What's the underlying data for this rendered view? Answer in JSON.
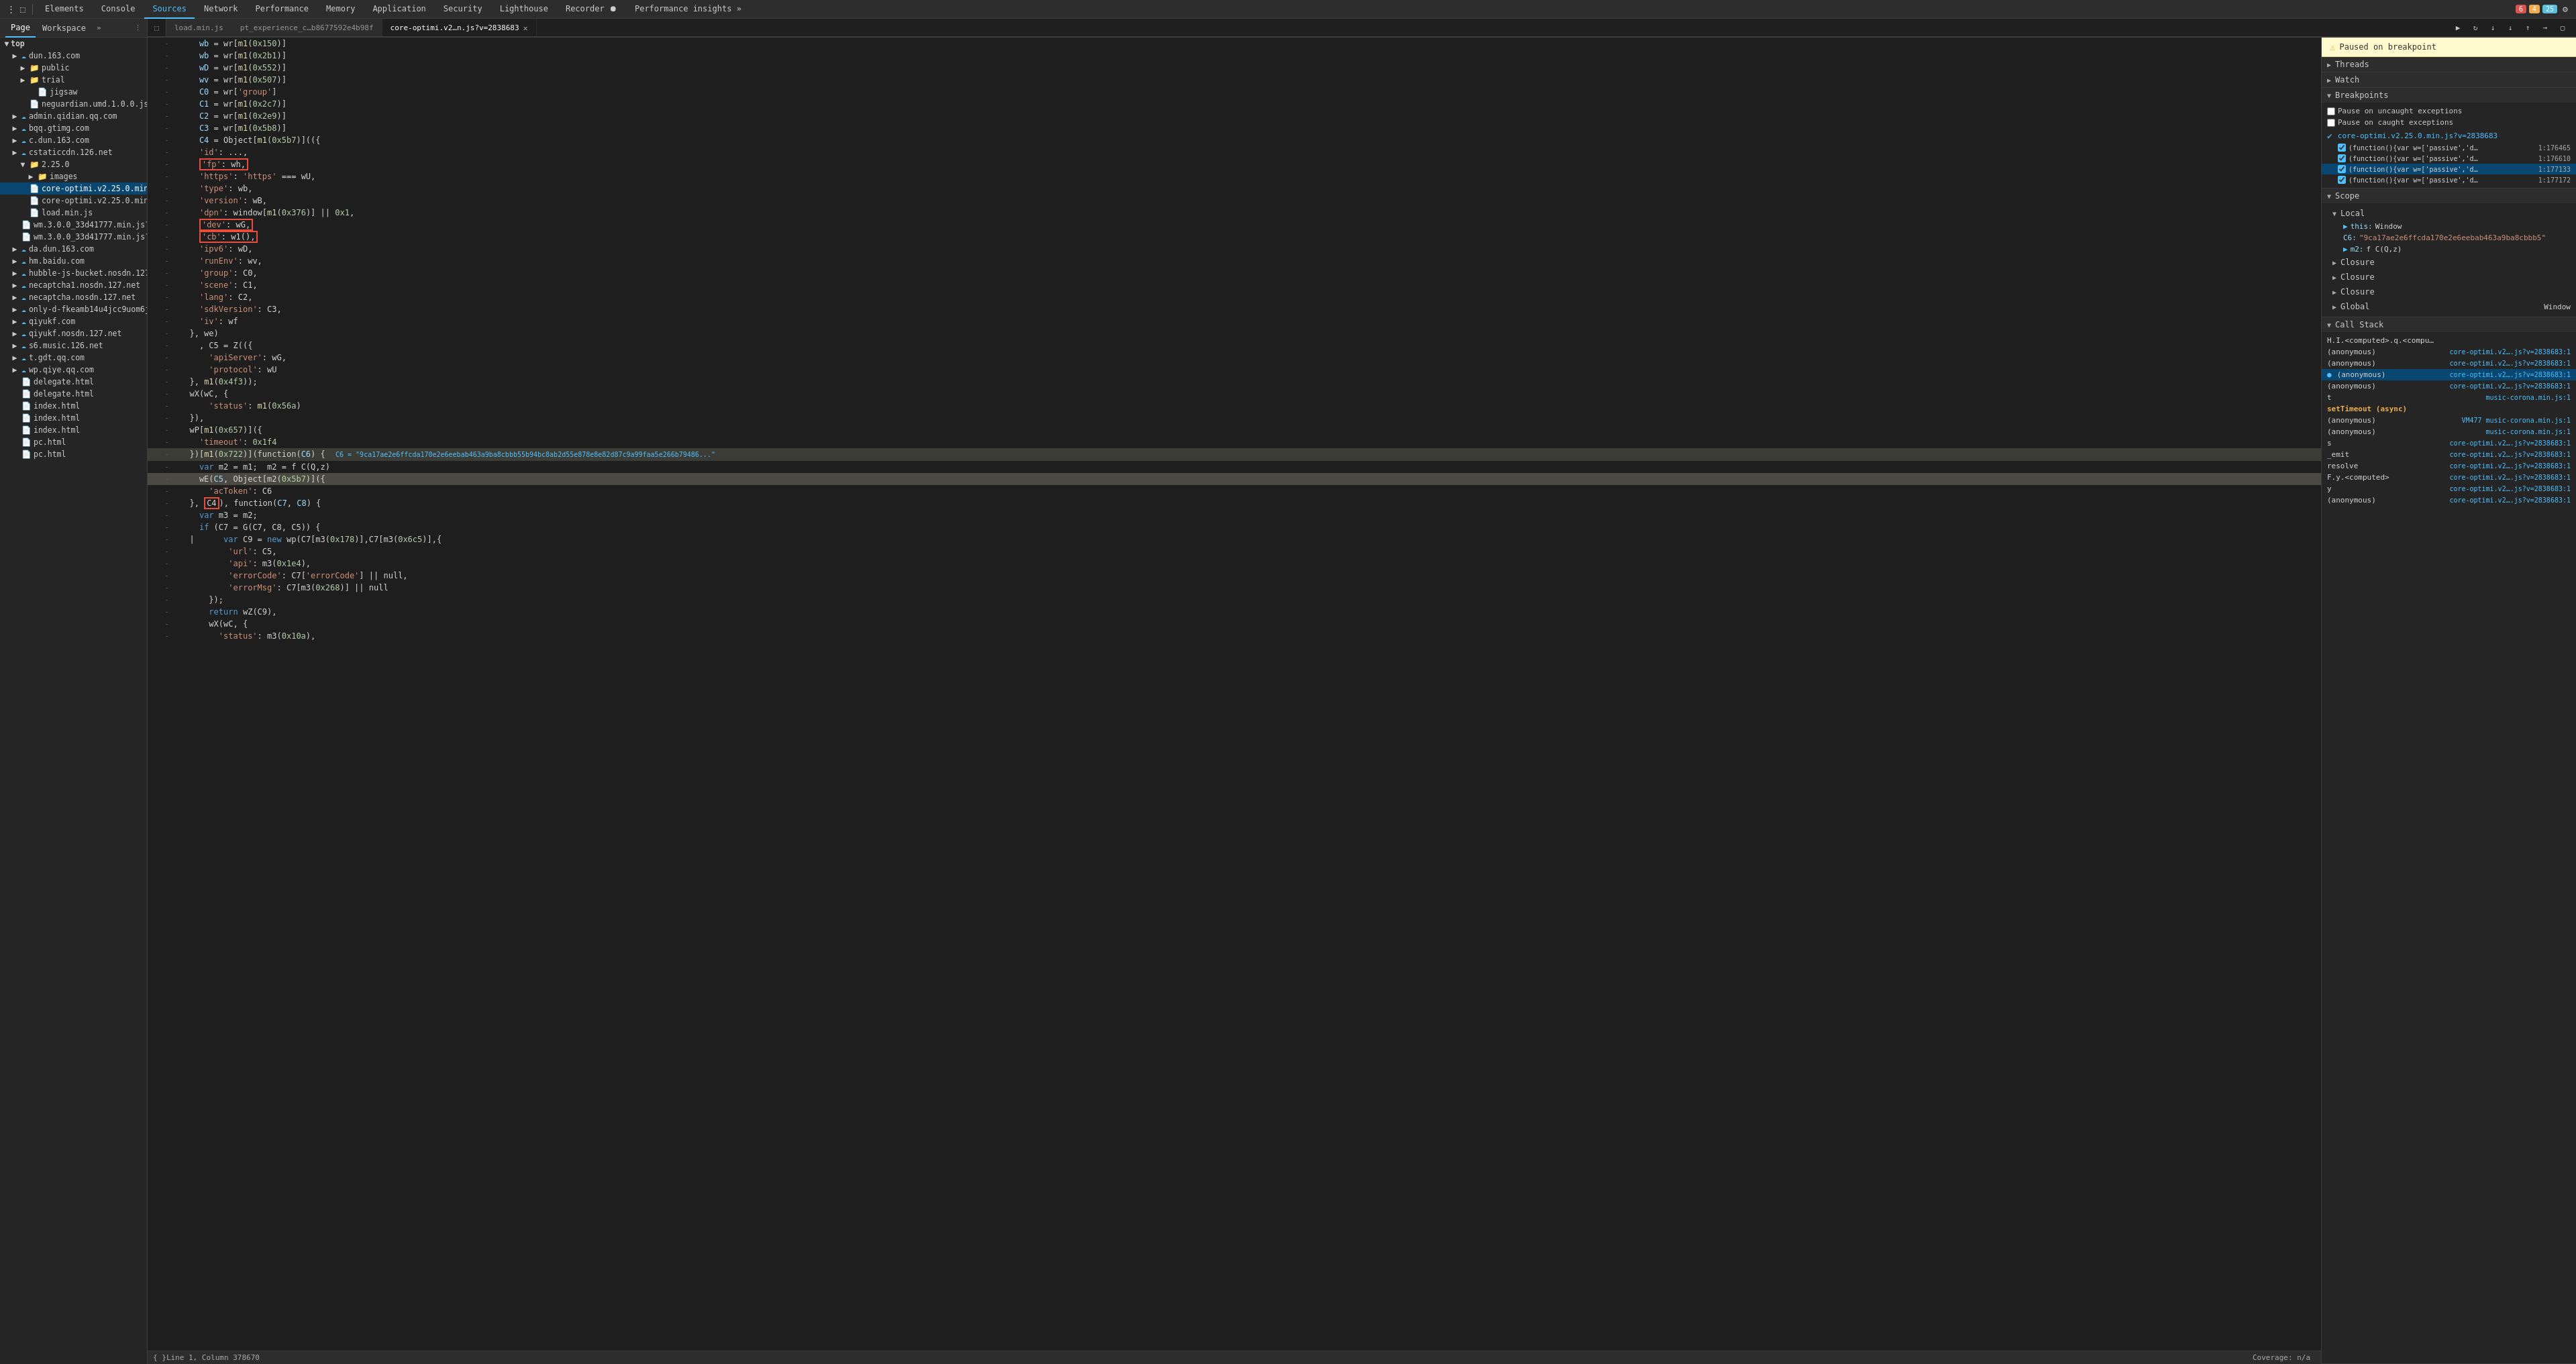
{
  "toolbar": {
    "tabs": [
      {
        "label": "Elements",
        "active": false
      },
      {
        "label": "Console",
        "active": false
      },
      {
        "label": "Sources",
        "active": true
      },
      {
        "label": "Network",
        "active": false
      },
      {
        "label": "Performance",
        "active": false
      },
      {
        "label": "Memory",
        "active": false
      },
      {
        "label": "Application",
        "active": false
      },
      {
        "label": "Security",
        "active": false
      },
      {
        "label": "Lighthouse",
        "active": false
      },
      {
        "label": "Recorder ⏺",
        "active": false
      },
      {
        "label": "Performance insights »",
        "active": false
      }
    ],
    "errors": "6",
    "warnings": "4",
    "info": "25"
  },
  "page_workspace": {
    "page_label": "Page",
    "workspace_label": "Workspace"
  },
  "file_tabs": [
    {
      "label": "load.min.js",
      "active": false,
      "closable": false
    },
    {
      "label": "pt_experience_c…b8677592e4b98f",
      "active": false,
      "closable": false
    },
    {
      "label": "core-optimi.v2…n.js?v=2838683",
      "active": true,
      "closable": true
    }
  ],
  "sidebar": {
    "top_label": "top",
    "items": [
      {
        "type": "folder",
        "label": "dun.163.com",
        "indent": 1,
        "cloud": true
      },
      {
        "type": "folder",
        "label": "public",
        "indent": 2
      },
      {
        "type": "folder",
        "label": "trial",
        "indent": 2
      },
      {
        "type": "file",
        "label": "jigsaw",
        "indent": 3
      },
      {
        "type": "file",
        "label": "neguardian.umd.1.0.0.js",
        "indent": 3
      },
      {
        "type": "folder",
        "label": "admin.qidian.qq.com",
        "indent": 1,
        "cloud": true
      },
      {
        "type": "folder",
        "label": "bqq.gtimg.com",
        "indent": 1,
        "cloud": true
      },
      {
        "type": "folder",
        "label": "c.dun.163.com",
        "indent": 1,
        "cloud": true
      },
      {
        "type": "folder",
        "label": "cstaticcdn.126.net",
        "indent": 1,
        "cloud": true
      },
      {
        "type": "folder",
        "label": "2.25.0",
        "indent": 2
      },
      {
        "type": "folder",
        "label": "images",
        "indent": 3
      },
      {
        "type": "file",
        "label": "core-optimi.v2.25.0.min.js?v…",
        "indent": 3,
        "selected": true
      },
      {
        "type": "file",
        "label": "core-optimi.v2.25.0.min.js?v…",
        "indent": 3
      },
      {
        "type": "file",
        "label": "load.min.js",
        "indent": 2
      },
      {
        "type": "file",
        "label": "wm.3.0.0_33d41777.min.js?v=2…",
        "indent": 2
      },
      {
        "type": "file",
        "label": "wm.3.0.0_33d41777.min.js?v=2…",
        "indent": 2
      },
      {
        "type": "folder",
        "label": "da.dun.163.com",
        "indent": 1,
        "cloud": true
      },
      {
        "type": "folder",
        "label": "hm.baidu.com",
        "indent": 1,
        "cloud": true
      },
      {
        "type": "folder",
        "label": "hubble-js-bucket.nosdn.127.net",
        "indent": 1,
        "cloud": true
      },
      {
        "type": "folder",
        "label": "necaptcha1.nosdn.127.net",
        "indent": 1,
        "cloud": true
      },
      {
        "type": "folder",
        "label": "necaptcha.nosdn.127.net",
        "indent": 1,
        "cloud": true
      },
      {
        "type": "folder",
        "label": "only-d-fkeamb14u4jcc9uom6jew…",
        "indent": 1,
        "cloud": true
      },
      {
        "type": "folder",
        "label": "qiyukf.com",
        "indent": 1,
        "cloud": true
      },
      {
        "type": "folder",
        "label": "qiyukf.nosdn.127.net",
        "indent": 1,
        "cloud": true
      },
      {
        "type": "folder",
        "label": "s6.music.126.net",
        "indent": 1,
        "cloud": true
      },
      {
        "type": "folder",
        "label": "t.gdt.qq.com",
        "indent": 1,
        "cloud": true
      },
      {
        "type": "folder",
        "label": "wp.qiye.qq.com",
        "indent": 1,
        "cloud": true
      },
      {
        "type": "file",
        "label": "delegate.html",
        "indent": 1
      },
      {
        "type": "file",
        "label": "delegate.html",
        "indent": 1
      },
      {
        "type": "file",
        "label": "index.html",
        "indent": 1
      },
      {
        "type": "file",
        "label": "index.html",
        "indent": 1
      },
      {
        "type": "file",
        "label": "index.html",
        "indent": 1
      },
      {
        "type": "file",
        "label": "pc.html",
        "indent": 1
      },
      {
        "type": "file",
        "label": "pc.html",
        "indent": 1
      }
    ]
  },
  "code": {
    "lines": [
      {
        "num": "",
        "content": "    wb = wr[m1(0x150)]"
      },
      {
        "num": "",
        "content": "    wb = wr[m1(0x2b1)]"
      },
      {
        "num": "",
        "content": "    wD = wr[m1(0x552)]"
      },
      {
        "num": "",
        "content": "    wv = wr[m1(0x507)]"
      },
      {
        "num": "",
        "content": "    C0 = wr['group']"
      },
      {
        "num": "",
        "content": "    C1 = wr[m1(0x2c7)]"
      },
      {
        "num": "",
        "content": "    C2 = wr[m1(0x2e9)]"
      },
      {
        "num": "",
        "content": "    C3 = wr[m1(0x5b8)]"
      },
      {
        "num": "",
        "content": "    C4 = Object[m1(0x5b7)](({"
      },
      {
        "num": "",
        "content": "    'id': ...,"
      },
      {
        "num": "",
        "content_redbox": "    'fp': wh,",
        "redbox": true
      },
      {
        "num": "",
        "content": "    'https': 'https' === wU,"
      },
      {
        "num": "",
        "content": "    'type': wb,"
      },
      {
        "num": "",
        "content": "    'version': wB,"
      },
      {
        "num": "",
        "content": "    'dpn': window[m1(0x376)] || 0x1,"
      },
      {
        "num": "",
        "content_redbox": "    'dev': wG,",
        "redbox": true
      },
      {
        "num": "",
        "content_redbox": "    'cb': w1(),",
        "redbox": true
      },
      {
        "num": "",
        "content": "    'ipv6': wD,"
      },
      {
        "num": "",
        "content": "    'runEnv': wv,"
      },
      {
        "num": "",
        "content": "    'group': C0,"
      },
      {
        "num": "",
        "content": "    'scene': C1,"
      },
      {
        "num": "",
        "content": "    'lang': C2,"
      },
      {
        "num": "",
        "content": "    'sdkVersion': C3,"
      },
      {
        "num": "",
        "content": "    'iv': wf"
      },
      {
        "num": "",
        "content": "  }, we)"
      },
      {
        "num": "",
        "content": "    , C5 = Z(({"
      },
      {
        "num": "",
        "content": "      'apiServer': wG,"
      },
      {
        "num": "",
        "content": "      'protocol': wU"
      },
      {
        "num": "",
        "content": "  }, m1(0x4f3));"
      },
      {
        "num": "",
        "content": "  wX(wC, {"
      },
      {
        "num": "",
        "content": "      'status': m1(0x56a)"
      },
      {
        "num": "",
        "content": "  }),"
      },
      {
        "num": "",
        "content": "  wP[m1(0x657)]({"
      },
      {
        "num": "",
        "content": "    'timeout': 0x1f4"
      },
      {
        "num": "",
        "content_inline": "  })[m1(0x722)](function(C6) {",
        "inline": "C6 = \"9ca17ae2e6ffcda170e2e6eebab463a9ba8cbbb55b94bc8ab2d55e878e8e82d87c9a99faa5e266b79486...\""
      },
      {
        "num": "",
        "content": "    var m2 = m1;  m2 = f C(Q,z)"
      },
      {
        "num": "",
        "content_active": "    wE(C5, Object[m2(0x5b7)]({",
        "active": true
      },
      {
        "num": "",
        "content": "      'acToken': C6"
      },
      {
        "num": "",
        "content": "  }, C4), function(C7, C8) {"
      },
      {
        "num": "",
        "content": "    var m3 = m2;"
      },
      {
        "num": "",
        "content": "    if (C7 = G(C7, C8, C5)) {"
      },
      {
        "num": "",
        "content": "  |      var C9 = new wp(C7[m3(0x178)],C7[m3(0x6c5)],{"
      },
      {
        "num": "",
        "content": "          'url': C5,"
      },
      {
        "num": "",
        "content": "          'api': m3(0x1e4),"
      },
      {
        "num": "",
        "content": "          'errorCode': C7['errorCode'] || null,"
      },
      {
        "num": "",
        "content": "          'errorMsg': C7[m3(0x268)] || null"
      },
      {
        "num": "",
        "content": "      });"
      },
      {
        "num": "",
        "content": "      return wZ(C9),"
      },
      {
        "num": "",
        "content": "      wX(wC, {"
      },
      {
        "num": "",
        "content": "        'status': m3(0x10a),"
      }
    ],
    "status_line": "Line 1, Column 378670",
    "coverage": "Coverage: n/a"
  },
  "right_panel": {
    "paused_text": "Paused on breakpoint",
    "sections": {
      "threads": "Threads",
      "watch": "Watch",
      "breakpoints": "Breakpoints",
      "pause_uncaught": "Pause on uncaught exceptions",
      "pause_caught": "Pause on caught exceptions",
      "breakpoints_file": "core-optimi.v2.25.0.min.js?v=2838683",
      "bp_items": [
        {
          "fn": "(function(){var w=['passive','d…",
          "line": "1:176465",
          "active": false,
          "checked": true
        },
        {
          "fn": "(function(){var w=['passive','d…",
          "line": "1:176610",
          "active": false,
          "checked": true
        },
        {
          "fn": "(function(){var w=['passive','d…",
          "line": "1:177133",
          "active": true,
          "checked": true
        },
        {
          "fn": "(function(){var w=['passive','d…",
          "line": "1:177172",
          "active": false,
          "checked": true
        }
      ],
      "scope": "Scope",
      "local": "Local",
      "local_items": [
        {
          "key": "▶ this:",
          "val": "Window"
        },
        {
          "key": "C6:",
          "val": "\"9ca17ae2e6ffcda170e2e6eebab463a9ba8cbbb5\""
        },
        {
          "key": "▶ m2:",
          "val": "f C(Q,z)"
        }
      ],
      "closure_items": [
        "Closure",
        "Closure",
        "Closure"
      ],
      "global_label": "Global",
      "global_val": "Window",
      "call_stack": "Call Stack",
      "call_stack_items": [
        {
          "fn": "H.I.<computed>.q.<computed>",
          "file": "",
          "active": false
        },
        {
          "fn": "(anonymous)",
          "file": "core-optimi.v2….js?v=2838683:1",
          "active": false
        },
        {
          "fn": "(anonymous)",
          "file": "core-optimi.v2….js?v=2838683:1",
          "active": false
        },
        {
          "fn": "(anonymous)",
          "file": "core-optimi.v2….js?v=2838683:1",
          "active": true
        },
        {
          "fn": "(anonymous)",
          "file": "core-optimi.v2….js?v=2838683:1",
          "active": false
        },
        {
          "fn": "t",
          "file": "music-corona.min.js:1",
          "active": false
        },
        {
          "fn": "setTimeout (async)",
          "file": "",
          "async": true
        },
        {
          "fn": "(anonymous)",
          "file": "VM477 music-corona.min.js:1",
          "active": false
        },
        {
          "fn": "(anonymous)",
          "file": "music-corona.min.js:1",
          "active": false
        },
        {
          "fn": "s",
          "file": "core-optimi.v2….js?v=2838683:1",
          "active": false
        },
        {
          "fn": "_emit",
          "file": "core-optimi.v2….js?v=2838683:1",
          "active": false
        },
        {
          "fn": "resolve",
          "file": "core-optimi.v2….js?v=2838683:1",
          "active": false
        },
        {
          "fn": "F.y.<computed>",
          "file": "core-optimi.v2….js?v=2838683:1",
          "active": false
        },
        {
          "fn": "y",
          "file": "core-optimi.v2….js?v=2838683:1",
          "active": false
        },
        {
          "fn": "(anonymous)",
          "file": "core-optimi.v2….js?v=2838683:1",
          "active": false
        }
      ]
    }
  }
}
